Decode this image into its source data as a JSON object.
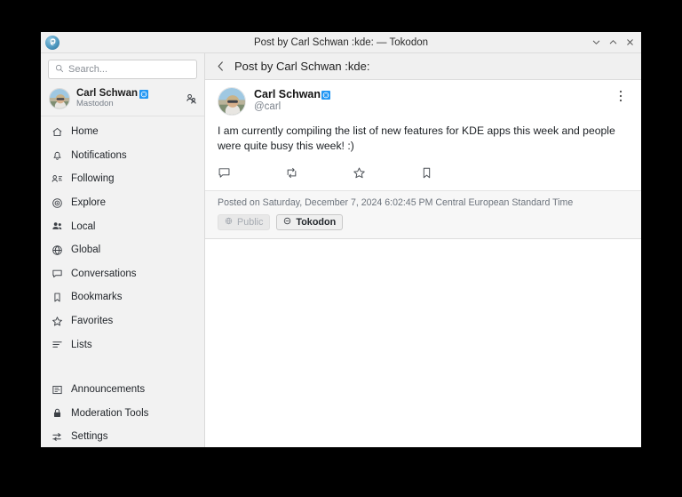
{
  "window": {
    "title": "Post by Carl Schwan :kde: — Tokodon",
    "app_icon": "tokodon-icon",
    "controls": {
      "minimize": "minimize-icon",
      "maximize": "maximize-icon",
      "close": "close-icon"
    }
  },
  "sidebar": {
    "search": {
      "placeholder": "Search...",
      "icon": "search-icon",
      "value": ""
    },
    "account": {
      "display_name": "Carl Schwan",
      "badge": "kde-emoji-badge",
      "server": "Mastodon",
      "avatar": "user-avatar",
      "switch_icon": "switch-account-icon"
    },
    "items": [
      {
        "label": "Home",
        "icon": "home-icon"
      },
      {
        "label": "Notifications",
        "icon": "bell-icon"
      },
      {
        "label": "Following",
        "icon": "following-icon"
      },
      {
        "label": "Explore",
        "icon": "explore-icon"
      },
      {
        "label": "Local",
        "icon": "people-icon"
      },
      {
        "label": "Global",
        "icon": "globe-icon"
      },
      {
        "label": "Conversations",
        "icon": "chat-icon"
      },
      {
        "label": "Bookmarks",
        "icon": "bookmark-icon"
      },
      {
        "label": "Favorites",
        "icon": "star-icon"
      },
      {
        "label": "Lists",
        "icon": "list-icon"
      }
    ],
    "items_bottom": [
      {
        "label": "Announcements",
        "icon": "announcement-icon"
      },
      {
        "label": "Moderation Tools",
        "icon": "lock-icon"
      },
      {
        "label": "Settings",
        "icon": "settings-sliders-icon"
      }
    ]
  },
  "content": {
    "header": {
      "title": "Post by Carl Schwan :kde:",
      "back_icon": "chevron-left-icon"
    },
    "post": {
      "display_name": "Carl Schwan",
      "badge": "kde-emoji-badge",
      "handle": "@carl",
      "avatar": "user-avatar",
      "menu_icon": "kebab-menu-icon",
      "text": "I am currently compiling the list of new features for KDE apps this week and people were quite busy this week! :)",
      "actions": [
        {
          "name": "reply",
          "icon": "reply-bubble-icon"
        },
        {
          "name": "boost",
          "icon": "boost-repeat-icon"
        },
        {
          "name": "favorite",
          "icon": "star-outline-icon"
        },
        {
          "name": "bookmark",
          "icon": "bookmark-outline-icon"
        }
      ],
      "posted_on": "Posted on Saturday, December 7, 2024 6:02:45 PM Central European Standard Time",
      "chips": [
        {
          "label": "Public",
          "icon": "globe-icon",
          "state": "disabled"
        },
        {
          "label": "Tokodon",
          "icon": "circle-minus-icon",
          "state": "active"
        }
      ]
    }
  },
  "colors": {
    "accent": "#2196f3",
    "sidebar_bg": "#f2f2f2",
    "titlebar_bg": "#f0f0f0",
    "content_bg": "#ffffff",
    "footer_bg": "#f7f7f7",
    "text": "#22262b",
    "muted": "#79808a"
  }
}
